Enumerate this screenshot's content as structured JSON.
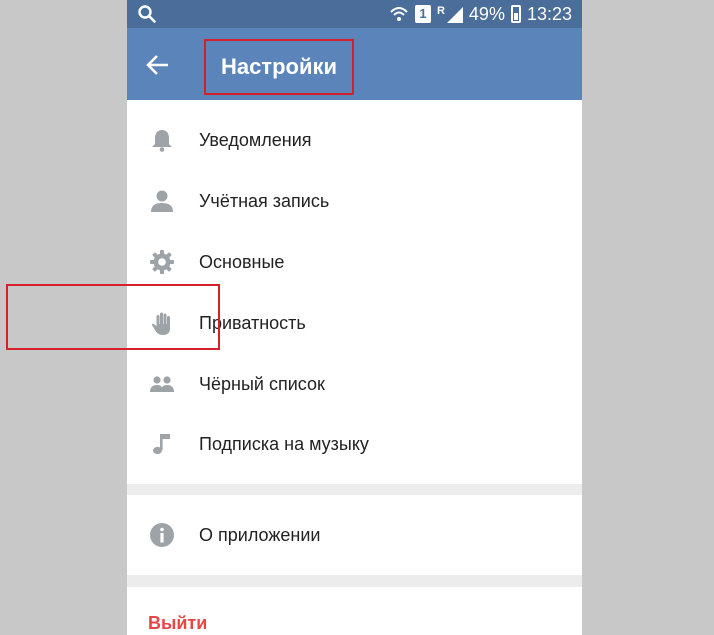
{
  "status_bar": {
    "battery": "49%",
    "time": "13:23",
    "sim": "1",
    "roaming": "R"
  },
  "header": {
    "title": "Настройки"
  },
  "menu": {
    "items": [
      {
        "label": "Уведомления",
        "icon": "bell-icon"
      },
      {
        "label": "Учётная запись",
        "icon": "person-icon"
      },
      {
        "label": "Основные",
        "icon": "gear-icon"
      },
      {
        "label": "Приватность",
        "icon": "hand-icon"
      },
      {
        "label": "Чёрный список",
        "icon": "people-icon"
      },
      {
        "label": "Подписка на музыку",
        "icon": "music-note-icon"
      }
    ]
  },
  "about": {
    "label": "О приложении",
    "icon": "info-icon"
  },
  "logout": {
    "label": "Выйти"
  },
  "colors": {
    "header": "#5b84bb",
    "status_bar": "#4a6d9a",
    "icon": "#9ea3a8",
    "logout": "#e64646",
    "highlight": "#d3202a"
  }
}
